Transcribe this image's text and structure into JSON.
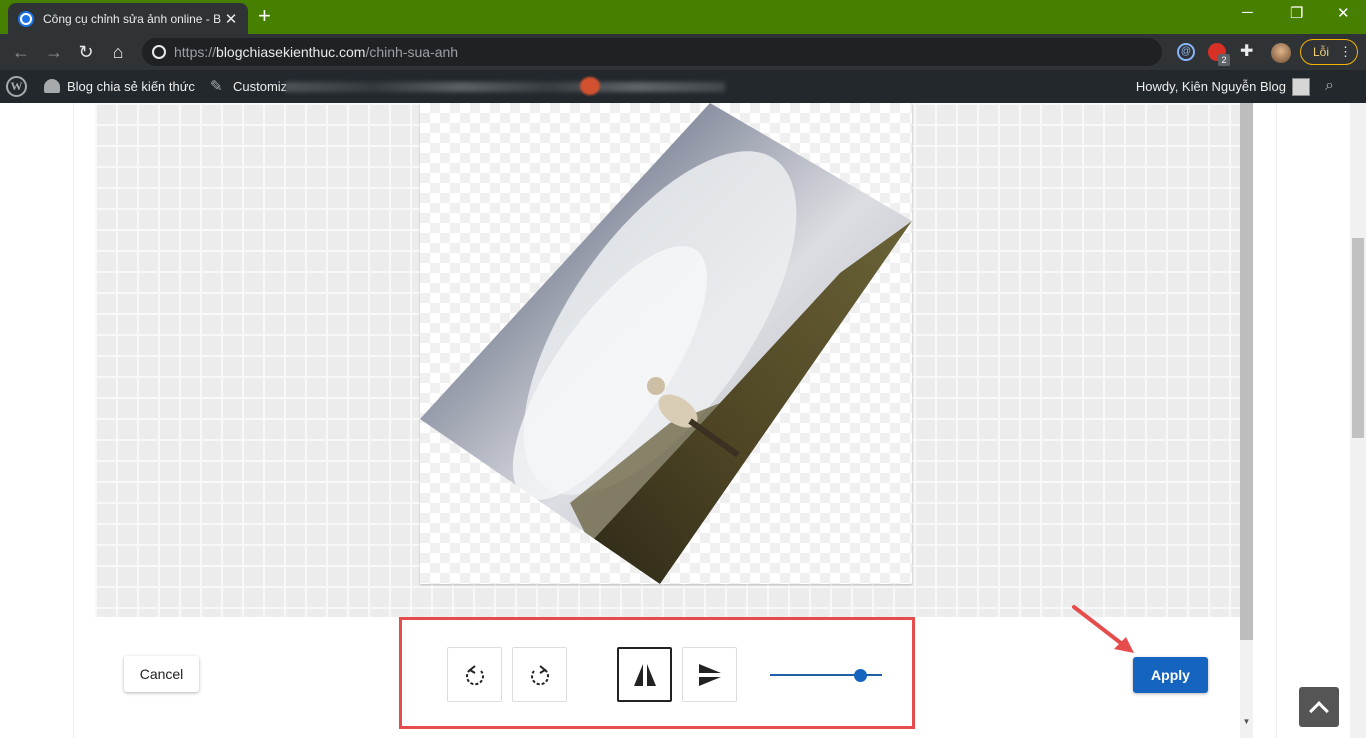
{
  "browser": {
    "tab_title": "Công cụ chỉnh sửa ảnh online - B",
    "url_scheme": "https://",
    "url_host": "blogchiasekienthuc.com",
    "url_path": "/chinh-sua-anh",
    "error_button_label": "Lỗi",
    "extension_badge_count": "2"
  },
  "admin_bar": {
    "site_name": "Blog chia sẻ kiến thức",
    "customize_label": "Customiz",
    "howdy_text": "Howdy, Kiên Nguyễn Blog"
  },
  "editor": {
    "cancel_label": "Cancel",
    "apply_label": "Apply",
    "rotation_slider_value": 0.85,
    "tools": [
      "rotate-left-icon",
      "rotate-right-icon",
      "flip-horizontal-icon",
      "flip-vertical-icon"
    ],
    "active_tool": "flip-horizontal-icon"
  },
  "colors": {
    "titlebar": "#477f00",
    "apply_button": "#1565c0",
    "annotation": "#e74c4c"
  }
}
